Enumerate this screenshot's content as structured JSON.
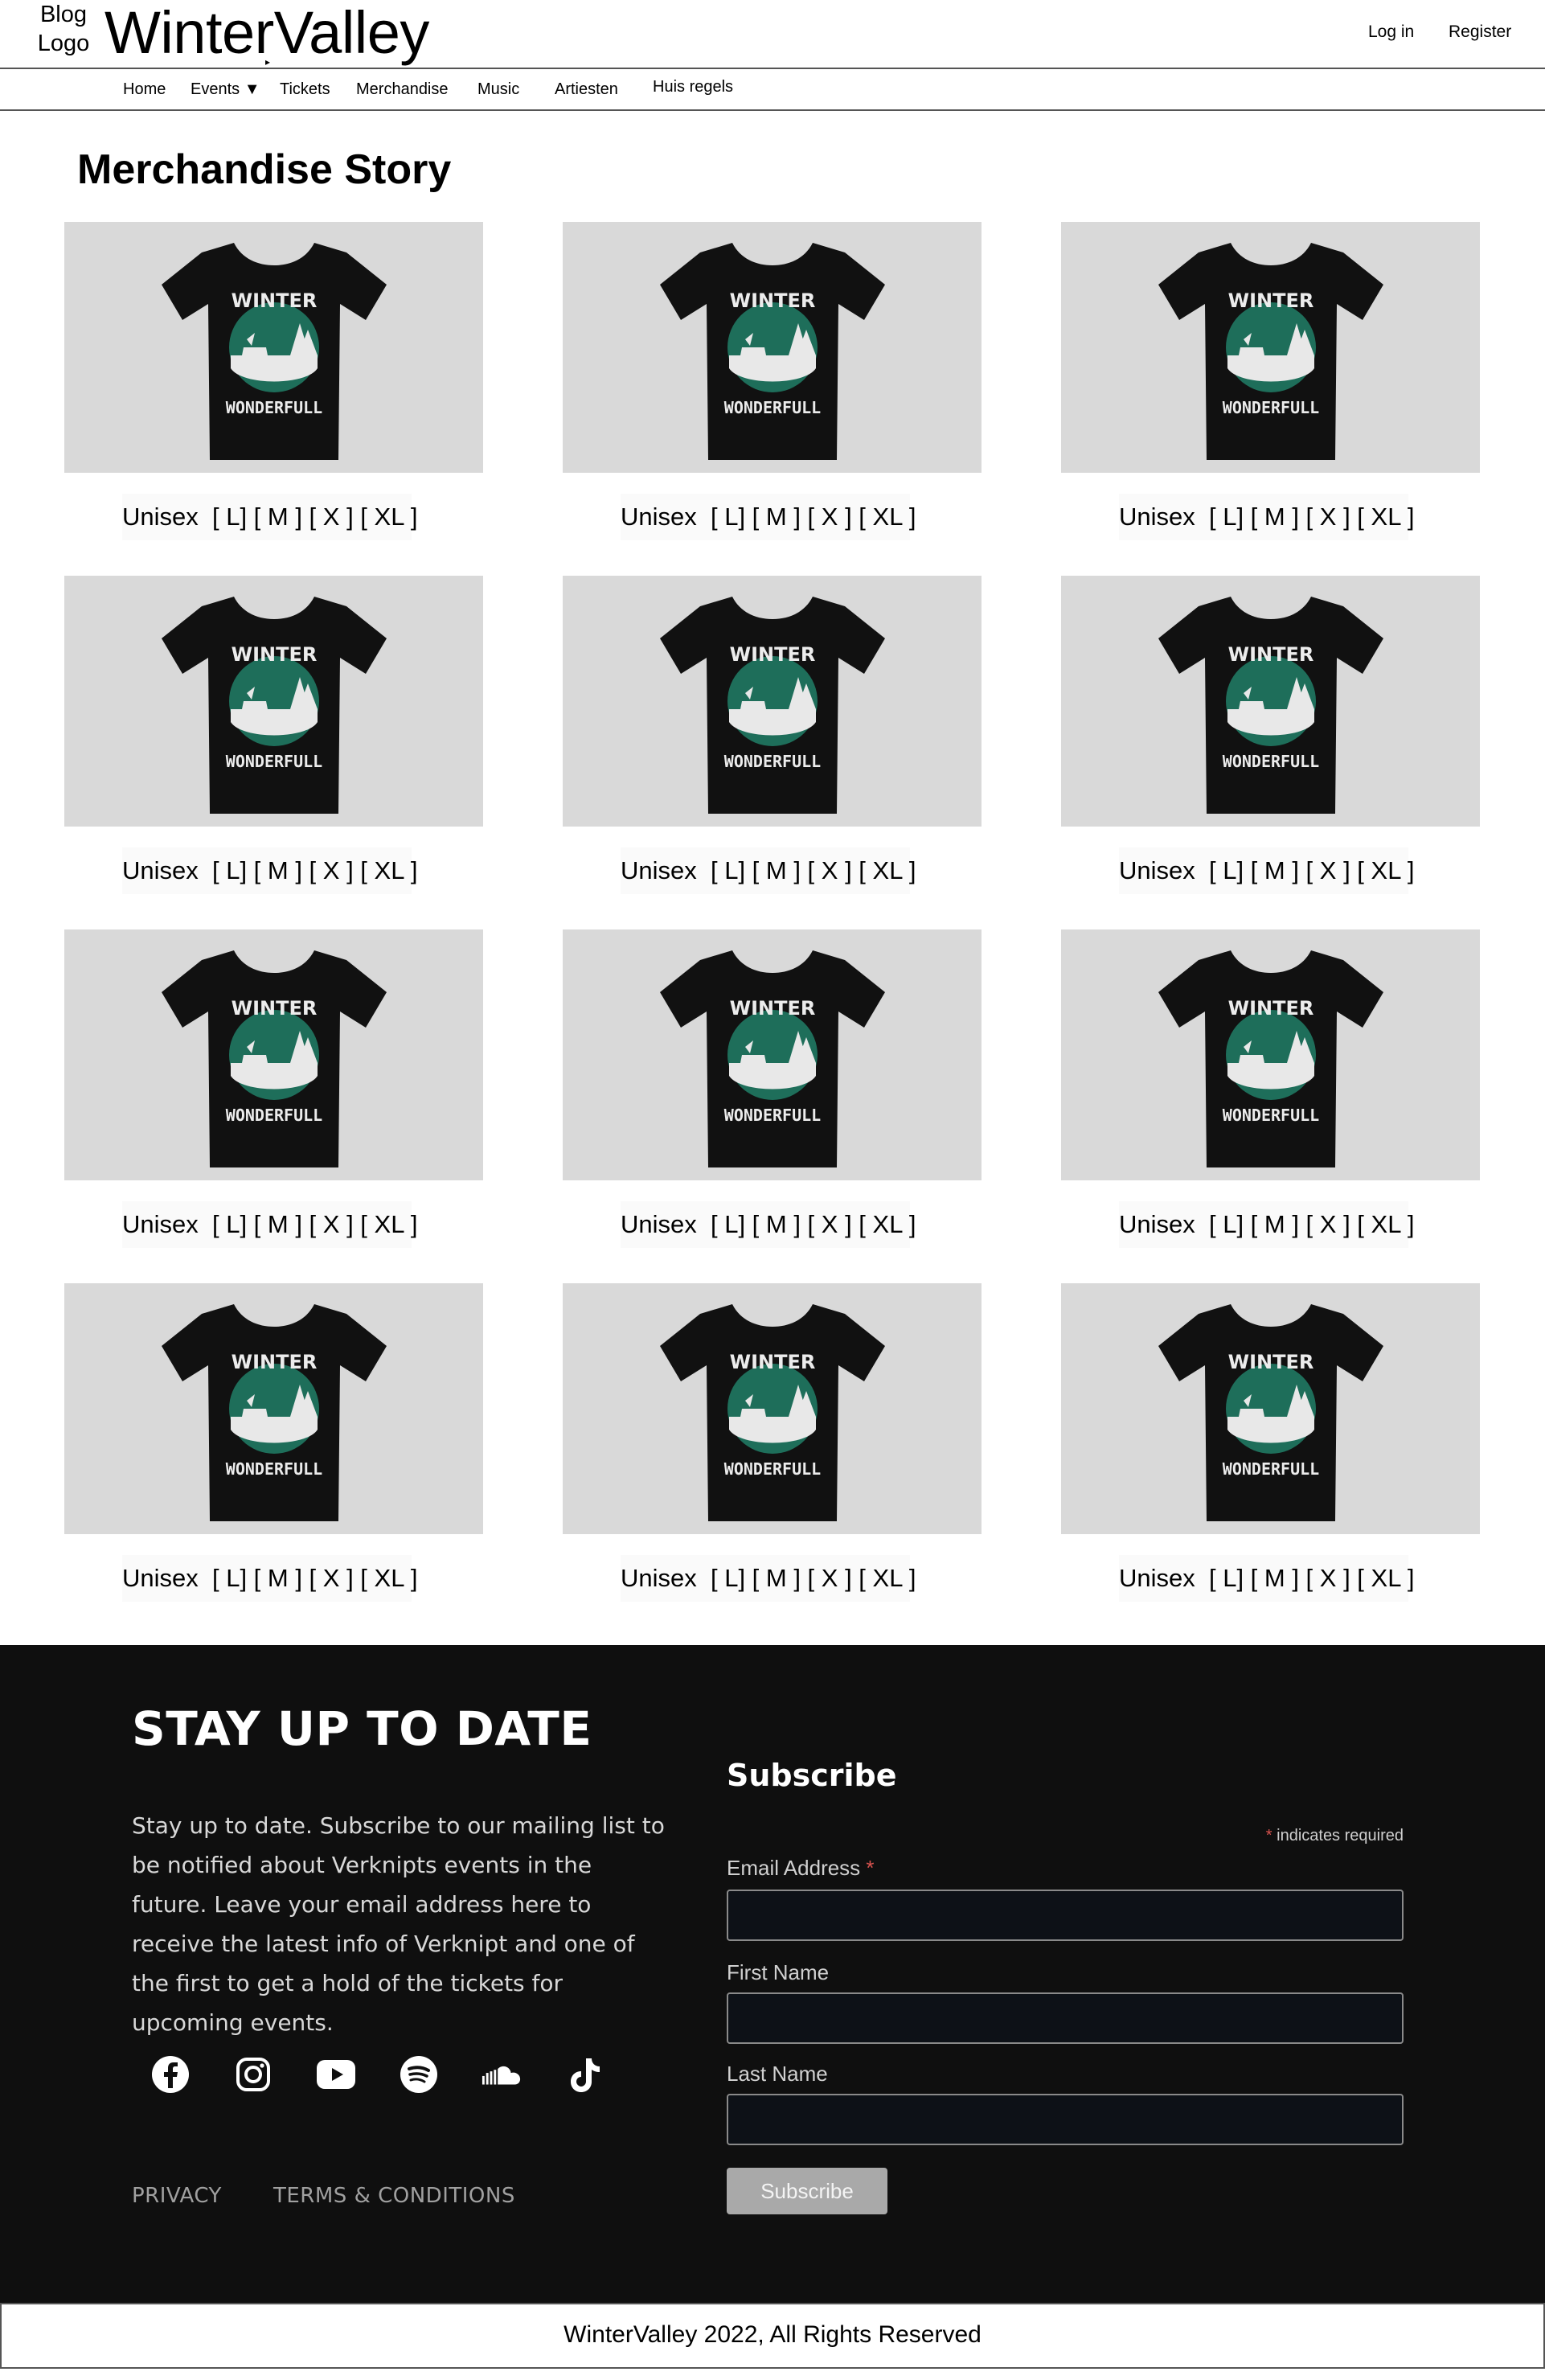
{
  "header": {
    "blog_logo_line1": "Blog",
    "blog_logo_line2": "Logo",
    "brand": "WinterValley",
    "login": "Log in",
    "register": "Register"
  },
  "nav": {
    "items": [
      "Home",
      "Events ▼",
      "Tickets",
      "Merchandise",
      "Music",
      "Artiesten",
      "Huis regels"
    ]
  },
  "page_title": "Merchandise Story",
  "product_image": {
    "shirt_word_top": "WINTER",
    "shirt_word_bottom": "WONDERFULL",
    "shirt_color": "#111111",
    "badge_color": "#1e6e5a",
    "background": "#d9d9d9"
  },
  "products": [
    {
      "caption": "Unisex  [ L] [ M ] [ X ] [ XL ]"
    },
    {
      "caption": "Unisex  [ L] [ M ] [ X ] [ XL ]"
    },
    {
      "caption": "Unisex  [ L] [ M ] [ X ] [ XL ]"
    },
    {
      "caption": "Unisex  [ L] [ M ] [ X ] [ XL ]"
    },
    {
      "caption": "Unisex  [ L] [ M ] [ X ] [ XL ]"
    },
    {
      "caption": "Unisex  [ L] [ M ] [ X ] [ XL ]"
    },
    {
      "caption": "Unisex  [ L] [ M ] [ X ] [ XL ]"
    },
    {
      "caption": "Unisex  [ L] [ M ] [ X ] [ XL ]"
    },
    {
      "caption": "Unisex  [ L] [ M ] [ X ] [ XL ]"
    },
    {
      "caption": "Unisex  [ L] [ M ] [ X ] [ XL ]"
    },
    {
      "caption": "Unisex  [ L] [ M ] [ X ] [ XL ]"
    },
    {
      "caption": "Unisex  [ L] [ M ] [ X ] [ XL ]"
    }
  ],
  "footer": {
    "heading": "STAY UP TO DATE",
    "text": "Stay up to date. Subscribe to our mailing list to be notified about Verknipts events in the future. Leave your email address here to receive the latest info of Verknipt and one of the first to get a hold of the tickets for upcoming events.",
    "socials": [
      "facebook-icon",
      "instagram-icon",
      "youtube-icon",
      "spotify-icon",
      "soundcloud-icon",
      "tiktok-icon"
    ],
    "privacy": "PRIVACY",
    "terms": "TERMS & CONDITIONS",
    "subscribe_title": "Subscribe",
    "required_star": "*",
    "required_note": "indicates required",
    "email_label": "Email Address",
    "first_name_label": "First Name",
    "last_name_label": "Last Name",
    "email_value": "",
    "first_name_value": "",
    "last_name_value": "",
    "subscribe_button": "Subscribe"
  },
  "copyright": "WinterValley 2022, All Rights Reserved"
}
